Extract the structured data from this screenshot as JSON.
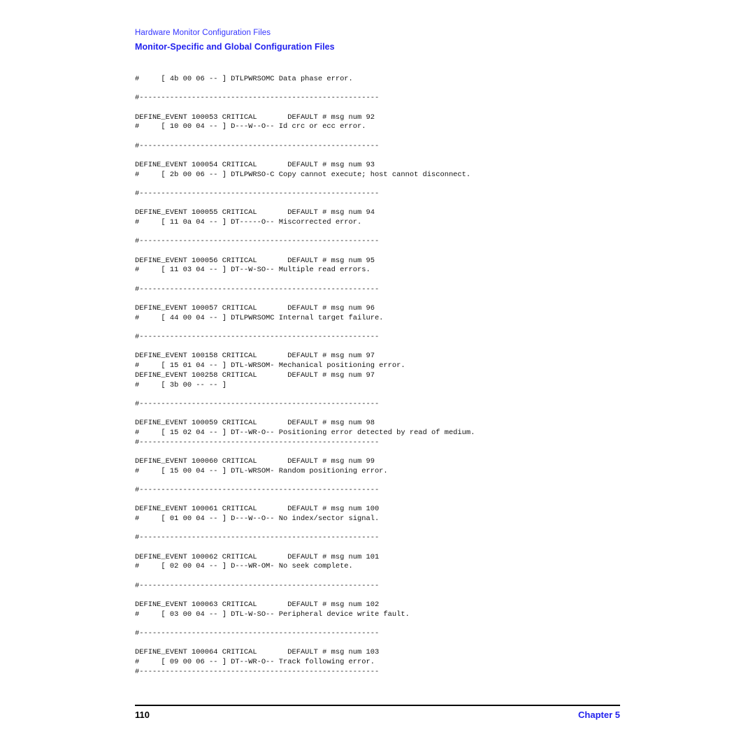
{
  "header": {
    "running_head": "Hardware Monitor Configuration Files",
    "section_title": "Monitor-Specific and Global Configuration Files"
  },
  "listing": {
    "separator": "#-------------------------------------------------------",
    "lines": [
      "#     [ 4b 00 06 -- ] DTLPWRSOMC Data phase error.",
      "",
      "#-------------------------------------------------------",
      "",
      "DEFINE_EVENT 100053 CRITICAL       DEFAULT # msg num 92",
      "#     [ 10 00 04 -- ] D---W--O-- Id crc or ecc error.",
      "",
      "#-------------------------------------------------------",
      "",
      "DEFINE_EVENT 100054 CRITICAL       DEFAULT # msg num 93",
      "#     [ 2b 00 06 -- ] DTLPWRSO-C Copy cannot execute; host cannot disconnect.",
      "",
      "#-------------------------------------------------------",
      "",
      "DEFINE_EVENT 100055 CRITICAL       DEFAULT # msg num 94",
      "#     [ 11 0a 04 -- ] DT-----O-- Miscorrected error.",
      "",
      "#-------------------------------------------------------",
      "",
      "DEFINE_EVENT 100056 CRITICAL       DEFAULT # msg num 95",
      "#     [ 11 03 04 -- ] DT--W-SO-- Multiple read errors.",
      "",
      "#-------------------------------------------------------",
      "",
      "DEFINE_EVENT 100057 CRITICAL       DEFAULT # msg num 96",
      "#     [ 44 00 04 -- ] DTLPWRSOMC Internal target failure.",
      "",
      "#-------------------------------------------------------",
      "",
      "DEFINE_EVENT 100158 CRITICAL       DEFAULT # msg num 97",
      "#     [ 15 01 04 -- ] DTL-WRSOM- Mechanical positioning error.",
      "DEFINE_EVENT 100258 CRITICAL       DEFAULT # msg num 97",
      "#     [ 3b 00 -- -- ]",
      "",
      "#-------------------------------------------------------",
      "",
      "DEFINE_EVENT 100059 CRITICAL       DEFAULT # msg num 98",
      "#     [ 15 02 04 -- ] DT--WR-O-- Positioning error detected by read of medium.",
      "#-------------------------------------------------------",
      "",
      "DEFINE_EVENT 100060 CRITICAL       DEFAULT # msg num 99",
      "#     [ 15 00 04 -- ] DTL-WRSOM- Random positioning error.",
      "",
      "#-------------------------------------------------------",
      "",
      "DEFINE_EVENT 100061 CRITICAL       DEFAULT # msg num 100",
      "#     [ 01 00 04 -- ] D---W--O-- No index/sector signal.",
      "",
      "#-------------------------------------------------------",
      "",
      "DEFINE_EVENT 100062 CRITICAL       DEFAULT # msg num 101",
      "#     [ 02 00 04 -- ] D---WR-OM- No seek complete.",
      "",
      "#-------------------------------------------------------",
      "",
      "DEFINE_EVENT 100063 CRITICAL       DEFAULT # msg num 102",
      "#     [ 03 00 04 -- ] DTL-W-SO-- Peripheral device write fault.",
      "",
      "#-------------------------------------------------------",
      "",
      "DEFINE_EVENT 100064 CRITICAL       DEFAULT # msg num 103",
      "#     [ 09 00 06 -- ] DT--WR-O-- Track following error.",
      "#-------------------------------------------------------"
    ]
  },
  "footer": {
    "page_number": "110",
    "chapter_label": "Chapter 5"
  },
  "colors": {
    "header_blue": "#3333ff",
    "title_blue": "#2222ee",
    "text_black": "#111111"
  }
}
